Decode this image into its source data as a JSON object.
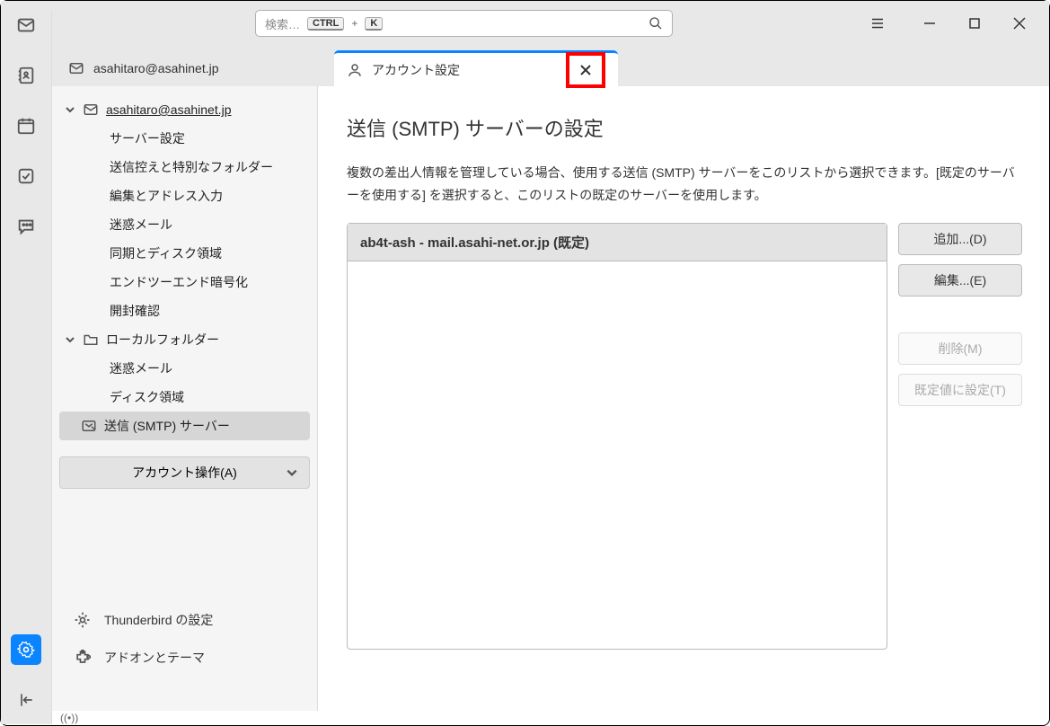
{
  "search": {
    "placeholder": "検索…",
    "kbd1": "CTRL",
    "plus": "+",
    "kbd2": "K"
  },
  "tabs": {
    "inactive": {
      "label": "asahitaro@asahinet.jp"
    },
    "active": {
      "label": "アカウント設定"
    }
  },
  "sidebar": {
    "account": {
      "email": "asahitaro@asahinet.jp"
    },
    "items": [
      "サーバー設定",
      "送信控えと特別なフォルダー",
      "編集とアドレス入力",
      "迷惑メール",
      "同期とディスク領域",
      "エンドツーエンド暗号化",
      "開封確認"
    ],
    "local": {
      "label": "ローカルフォルダー"
    },
    "local_items": [
      "迷惑メール",
      "ディスク領域"
    ],
    "smtp": {
      "label": "送信 (SMTP) サーバー"
    },
    "account_ops": "アカウント操作(A)",
    "footer": {
      "settings": "Thunderbird の設定",
      "addons": "アドオンとテーマ"
    }
  },
  "panel": {
    "title": "送信 (SMTP) サーバーの設定",
    "description": "複数の差出人情報を管理している場合、使用する送信 (SMTP) サーバーをこのリストから選択できます。[既定のサーバーを使用する] を選択すると、このリストの既定のサーバーを使用します。",
    "server_item": "ab4t-ash - mail.asahi-net.or.jp (既定)",
    "buttons": {
      "add": "追加...(D)",
      "edit": "編集...(E)",
      "remove": "削除(M)",
      "default": "既定値に設定(T)"
    }
  },
  "statusbar": {
    "icon": "((•))"
  }
}
